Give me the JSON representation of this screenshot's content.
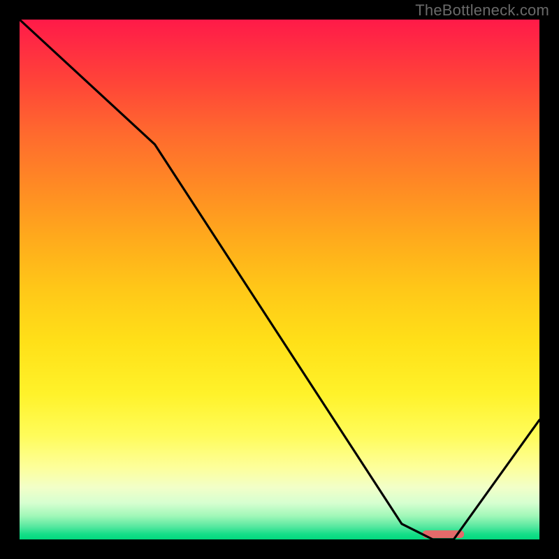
{
  "watermark": "TheBottleneck.com",
  "chart_data": {
    "type": "line",
    "title": "",
    "xlabel": "",
    "ylabel": "",
    "xlim": [
      0,
      100
    ],
    "ylim": [
      0,
      100
    ],
    "grid": false,
    "series": [
      {
        "name": "curve",
        "x": [
          0,
          26,
          73.5,
          79.5,
          83.5,
          100
        ],
        "values": [
          100,
          76,
          3,
          0,
          0,
          23
        ],
        "color": "#000000"
      }
    ],
    "highlight_segment": {
      "name": "optimal-range",
      "x_start": 77.5,
      "x_end": 85.5,
      "y": 0.8,
      "color": "#e46a6a"
    },
    "background_gradient": {
      "stops": [
        {
          "pos": 0.0,
          "color": "#ff1a48"
        },
        {
          "pos": 0.5,
          "color": "#ffc818"
        },
        {
          "pos": 0.85,
          "color": "#fdff99"
        },
        {
          "pos": 1.0,
          "color": "#02d97e"
        }
      ]
    }
  }
}
